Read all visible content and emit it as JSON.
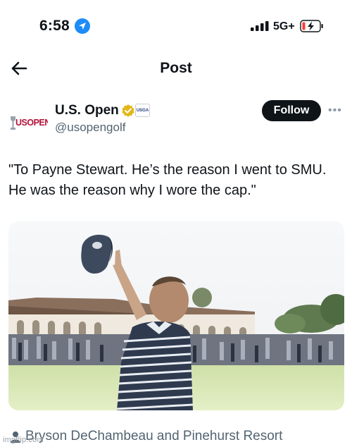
{
  "status_bar": {
    "time": "6:58",
    "network": "5G+",
    "location_icon": "location-arrow-icon",
    "signal_icon": "signal-bars-icon",
    "battery_icon": "battery-low-charging-icon",
    "battery_color": "#ff3b30"
  },
  "header": {
    "title": "Post",
    "back_icon": "arrow-left-icon"
  },
  "author": {
    "display_name": "U.S. Open",
    "handle": "@usopengolf",
    "avatar_text": "USOPEN",
    "affiliate_badge_text": "USGA",
    "verified_color": "#e2b719",
    "follow_label": "Follow",
    "more_label": "•••"
  },
  "post": {
    "text": "\"To Payne Stewart. He’s the reason I went to SMU. He was the reason why I wore the cap.\""
  },
  "media": {
    "icon": "photo-golfer-pointing-up"
  },
  "tagged": {
    "text": "Bryson DeChambeau and Pinehurst Resort",
    "icon": "person-icon"
  },
  "watermark": {
    "text": "imgflip.com"
  }
}
